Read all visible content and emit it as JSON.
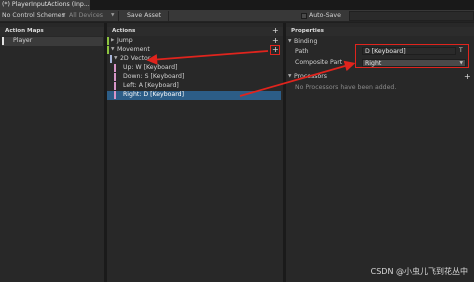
{
  "window": {
    "title": "(*) PlayerInputActions (Inp..."
  },
  "toolbar": {
    "control_schemes": "No Control Schemes",
    "devices": "All Devices",
    "save_asset": "Save Asset",
    "auto_save": "Auto-Save"
  },
  "action_maps": {
    "header": "Action Maps",
    "items": [
      {
        "label": "Player"
      }
    ]
  },
  "actions": {
    "header": "Actions",
    "add_icon": "+",
    "items": [
      {
        "label": "Jump",
        "stripe": "#8cc43f"
      },
      {
        "label": "Movement",
        "stripe": "#8cc43f"
      },
      {
        "label": "2D Vector",
        "stripe": "#a7b4d8"
      },
      {
        "label": "Up: W [Keyboard]",
        "stripe": "#d795c8"
      },
      {
        "label": "Down: S [Keyboard]",
        "stripe": "#d795c8"
      },
      {
        "label": "Left: A [Keyboard]",
        "stripe": "#d795c8"
      },
      {
        "label": "Right: D [Keyboard]",
        "stripe": "#d795c8"
      }
    ]
  },
  "properties": {
    "header": "Properties",
    "binding_section": "Binding",
    "path_label": "Path",
    "path_value": "D [Keyboard]",
    "composite_part_label": "Composite Part",
    "composite_part_value": "Right",
    "processors_section": "Processors",
    "processors_empty": "No Processors have been added."
  },
  "annotation_color": "#e0241d",
  "selection_color": "#2c5d87",
  "watermark": "CSDN @小虫儿飞到花丛中"
}
